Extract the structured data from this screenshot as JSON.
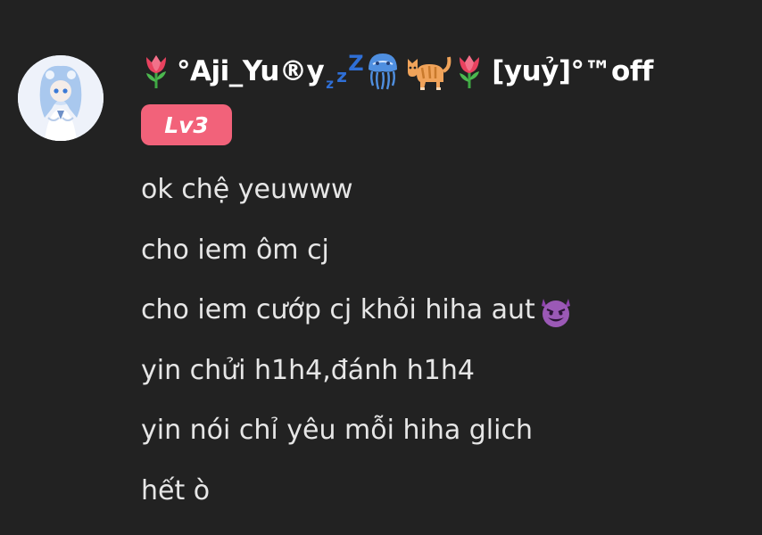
{
  "comment": {
    "avatar": {
      "icon": "anime-avatar-icon"
    },
    "username": {
      "prefix_emoji": "tulip-icon",
      "name_part": "°Aji_Yu®y",
      "zzz": [
        "z",
        "z",
        "Z"
      ],
      "emojis_middle": [
        "jellyfish-icon",
        "cat-icon",
        "tulip-icon"
      ],
      "suffix": "[yuỷ]°™off"
    },
    "badge": {
      "label": "Lv3",
      "color": "#f2627a"
    },
    "lines": [
      "ok chệ yeuwww",
      "cho iem ôm cj",
      "cho iem cướp cj khỏi hiha aut",
      "yin chửi h1h4,đánh h1h4",
      "yin nói chỉ yêu mỗi hiha glich",
      "hết ò"
    ],
    "line3_emoji": "smiling-devil-icon"
  },
  "colors": {
    "background": "#222222",
    "text": "#e6e6e6",
    "username": "#ffffff",
    "zzz": "#2f6fd6"
  }
}
